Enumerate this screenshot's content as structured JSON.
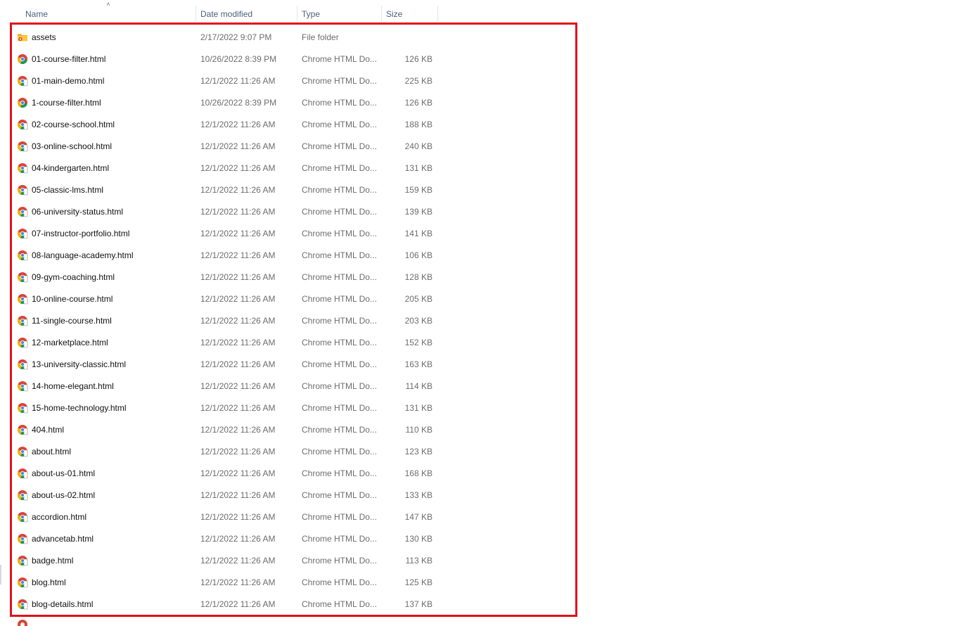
{
  "columns": {
    "name": "Name",
    "date_modified": "Date modified",
    "type": "Type",
    "size": "Size"
  },
  "sort": {
    "column": "name",
    "direction": "ascending",
    "icon": "chevron-up-icon"
  },
  "colors": {
    "highlight_border": "#e0101c",
    "header_text": "#4c607a",
    "folder": "#f5b800"
  },
  "files": [
    {
      "name": "assets",
      "date": "2/17/2022 9:07 PM",
      "type": "File folder",
      "size": "",
      "icon": "folder-icon"
    },
    {
      "name": "01-course-filter.html",
      "date": "10/26/2022 8:39 PM",
      "type": "Chrome HTML Do...",
      "size": "126 KB",
      "icon": "chrome-icon"
    },
    {
      "name": "01-main-demo.html",
      "date": "12/1/2022 11:26 AM",
      "type": "Chrome HTML Do...",
      "size": "225 KB",
      "icon": "chrome-icon"
    },
    {
      "name": "1-course-filter.html",
      "date": "10/26/2022 8:39 PM",
      "type": "Chrome HTML Do...",
      "size": "126 KB",
      "icon": "chrome-icon"
    },
    {
      "name": "02-course-school.html",
      "date": "12/1/2022 11:26 AM",
      "type": "Chrome HTML Do...",
      "size": "188 KB",
      "icon": "chrome-icon"
    },
    {
      "name": "03-online-school.html",
      "date": "12/1/2022 11:26 AM",
      "type": "Chrome HTML Do...",
      "size": "240 KB",
      "icon": "chrome-icon"
    },
    {
      "name": "04-kindergarten.html",
      "date": "12/1/2022 11:26 AM",
      "type": "Chrome HTML Do...",
      "size": "131 KB",
      "icon": "chrome-icon"
    },
    {
      "name": "05-classic-lms.html",
      "date": "12/1/2022 11:26 AM",
      "type": "Chrome HTML Do...",
      "size": "159 KB",
      "icon": "chrome-icon"
    },
    {
      "name": "06-university-status.html",
      "date": "12/1/2022 11:26 AM",
      "type": "Chrome HTML Do...",
      "size": "139 KB",
      "icon": "chrome-icon"
    },
    {
      "name": "07-instructor-portfolio.html",
      "date": "12/1/2022 11:26 AM",
      "type": "Chrome HTML Do...",
      "size": "141 KB",
      "icon": "chrome-icon"
    },
    {
      "name": "08-language-academy.html",
      "date": "12/1/2022 11:26 AM",
      "type": "Chrome HTML Do...",
      "size": "106 KB",
      "icon": "chrome-icon"
    },
    {
      "name": "09-gym-coaching.html",
      "date": "12/1/2022 11:26 AM",
      "type": "Chrome HTML Do...",
      "size": "128 KB",
      "icon": "chrome-icon"
    },
    {
      "name": "10-online-course.html",
      "date": "12/1/2022 11:26 AM",
      "type": "Chrome HTML Do...",
      "size": "205 KB",
      "icon": "chrome-icon"
    },
    {
      "name": "11-single-course.html",
      "date": "12/1/2022 11:26 AM",
      "type": "Chrome HTML Do...",
      "size": "203 KB",
      "icon": "chrome-icon"
    },
    {
      "name": "12-marketplace.html",
      "date": "12/1/2022 11:26 AM",
      "type": "Chrome HTML Do...",
      "size": "152 KB",
      "icon": "chrome-icon"
    },
    {
      "name": "13-university-classic.html",
      "date": "12/1/2022 11:26 AM",
      "type": "Chrome HTML Do...",
      "size": "163 KB",
      "icon": "chrome-icon"
    },
    {
      "name": "14-home-elegant.html",
      "date": "12/1/2022 11:26 AM",
      "type": "Chrome HTML Do...",
      "size": "114 KB",
      "icon": "chrome-icon"
    },
    {
      "name": "15-home-technology.html",
      "date": "12/1/2022 11:26 AM",
      "type": "Chrome HTML Do...",
      "size": "131 KB",
      "icon": "chrome-icon"
    },
    {
      "name": "404.html",
      "date": "12/1/2022 11:26 AM",
      "type": "Chrome HTML Do...",
      "size": "110 KB",
      "icon": "chrome-icon"
    },
    {
      "name": "about.html",
      "date": "12/1/2022 11:26 AM",
      "type": "Chrome HTML Do...",
      "size": "123 KB",
      "icon": "chrome-icon"
    },
    {
      "name": "about-us-01.html",
      "date": "12/1/2022 11:26 AM",
      "type": "Chrome HTML Do...",
      "size": "168 KB",
      "icon": "chrome-icon"
    },
    {
      "name": "about-us-02.html",
      "date": "12/1/2022 11:26 AM",
      "type": "Chrome HTML Do...",
      "size": "133 KB",
      "icon": "chrome-icon"
    },
    {
      "name": "accordion.html",
      "date": "12/1/2022 11:26 AM",
      "type": "Chrome HTML Do...",
      "size": "147 KB",
      "icon": "chrome-icon"
    },
    {
      "name": "advancetab.html",
      "date": "12/1/2022 11:26 AM",
      "type": "Chrome HTML Do...",
      "size": "130 KB",
      "icon": "chrome-icon"
    },
    {
      "name": "badge.html",
      "date": "12/1/2022 11:26 AM",
      "type": "Chrome HTML Do...",
      "size": "113 KB",
      "icon": "chrome-icon"
    },
    {
      "name": "blog.html",
      "date": "12/1/2022 11:26 AM",
      "type": "Chrome HTML Do...",
      "size": "125 KB",
      "icon": "chrome-icon"
    },
    {
      "name": "blog-details.html",
      "date": "12/1/2022 11:26 AM",
      "type": "Chrome HTML Do...",
      "size": "137 KB",
      "icon": "chrome-icon"
    }
  ]
}
